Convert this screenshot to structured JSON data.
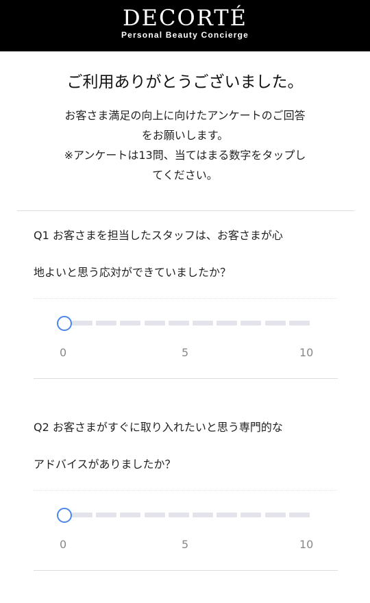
{
  "header": {
    "brand": "DECORTÉ",
    "tagline": "Personal Beauty Concierge"
  },
  "thanks_title": "ご利用ありがとうございました。",
  "intro_lines": [
    "お客さま満足の向上に向けたアンケートのご回答",
    "をお願いします。",
    "※アンケートは13問、当てはまる数字をタップし",
    "てください。"
  ],
  "questions": [
    {
      "text_lines": [
        "Q1 お客さまを担当したスタッフは、お客さまが心",
        "地よいと思う応対ができていましたか？"
      ],
      "scale_min_label": "0",
      "scale_mid_label": "5",
      "scale_max_label": "10",
      "selected_value": 0
    },
    {
      "text_lines": [
        "Q2 お客さまがすぐに取り入れたいと思う専門的な",
        "アドバイスがありましたか？"
      ],
      "scale_min_label": "0",
      "scale_mid_label": "5",
      "scale_max_label": "10",
      "selected_value": 0
    }
  ],
  "colors": {
    "header_bg": "#000000",
    "slider_accent": "#4a86e8",
    "slider_track": "#e3e3ec"
  }
}
